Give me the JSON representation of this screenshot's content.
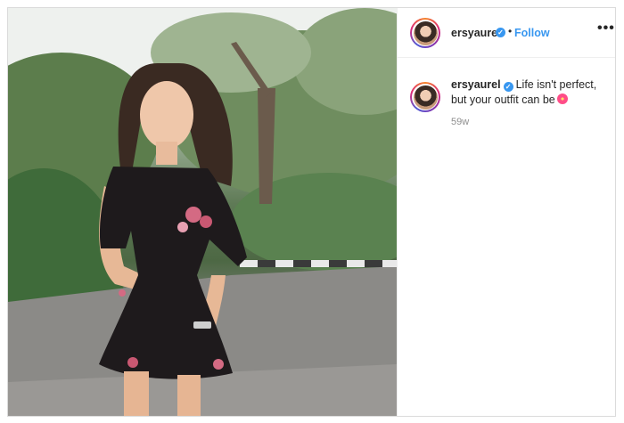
{
  "post": {
    "username": "ersyaurel",
    "verified_icon": "verified-badge-icon",
    "separator": "•",
    "follow_label": "Follow",
    "more_label": "•••",
    "caption": {
      "username": "ersyaurel",
      "text": "Life isn't perfect, but your outfit can be",
      "emoji_icon": "hibiscus-icon"
    },
    "time_ago": "59w"
  },
  "colors": {
    "accent": "#3897f0",
    "text": "#262626",
    "muted": "#8e8e8e",
    "border": "#dbdbdb"
  }
}
